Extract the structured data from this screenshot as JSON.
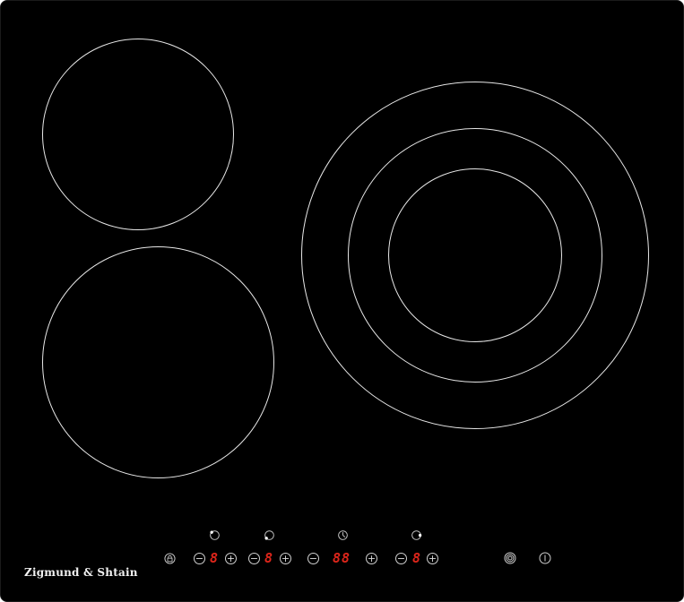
{
  "brand": {
    "name": "Zigmund & Shtain"
  },
  "colors": {
    "glass": "#000000",
    "zone_outline": "#e8e8e8",
    "display": "#e0261b",
    "control": "#cfcfcf"
  },
  "zones": [
    {
      "id": "back-left",
      "shape": "single-ring"
    },
    {
      "id": "front-left",
      "shape": "single-ring"
    },
    {
      "id": "right",
      "shape": "triple-ring"
    }
  ],
  "controls": {
    "lock": {
      "icon": "lock-icon"
    },
    "zone_indicators": [
      {
        "icon": "zone-indicator-back-left-icon"
      },
      {
        "icon": "zone-indicator-front-left-icon"
      },
      {
        "icon": "timer-clock-icon"
      },
      {
        "icon": "zone-indicator-right-icon"
      }
    ],
    "minus_symbol": "−",
    "plus_symbol": "+",
    "displays": {
      "zone_1": "8",
      "zone_2": "8",
      "timer": "88",
      "zone_3": "8"
    },
    "dual_zone": {
      "icon": "dual-ring-icon"
    },
    "power": {
      "icon": "power-icon"
    }
  }
}
